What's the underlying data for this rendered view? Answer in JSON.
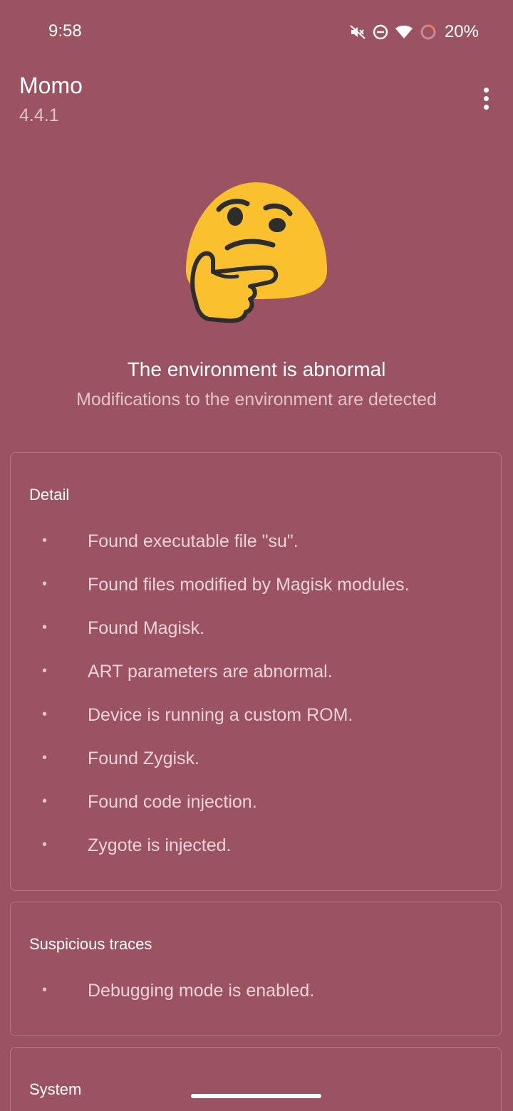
{
  "status_bar": {
    "time": "9:58",
    "battery": "20%",
    "icons": [
      "mute-icon",
      "do-not-disturb-icon",
      "wifi-icon",
      "battery-ring-icon"
    ]
  },
  "app_bar": {
    "title": "Momo",
    "version": "4.4.1",
    "menu_icon": "more-vert-icon"
  },
  "status": {
    "emoji": "thinking-face-icon",
    "headline": "The environment is abnormal",
    "subline": "Modifications to the environment are detected"
  },
  "cards": {
    "detail": {
      "title": "Detail",
      "items": [
        "Found executable file \"su\".",
        "Found files modified by Magisk modules.",
        "Found Magisk.",
        "ART parameters are abnormal.",
        "Device is running a custom ROM.",
        "Found Zygisk.",
        "Found code injection.",
        "Zygote is injected."
      ]
    },
    "traces": {
      "title": "Suspicious traces",
      "items": [
        "Debugging mode is enabled."
      ]
    },
    "system": {
      "title": "System"
    }
  },
  "bullet": "•",
  "colors": {
    "background": "#9b5261",
    "card_border": "#b37886",
    "secondary_text": "#e2c3ca",
    "emoji_yellow": "#fbc02d"
  }
}
